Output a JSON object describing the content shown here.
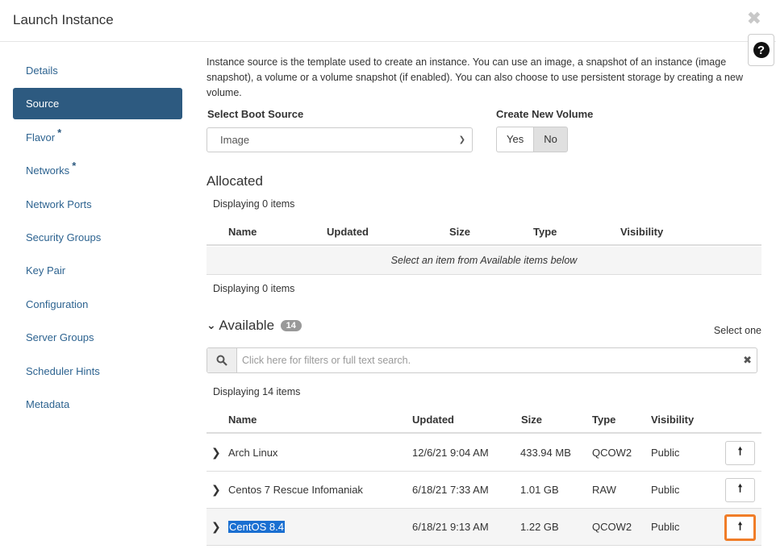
{
  "modal": {
    "title": "Launch Instance",
    "close_glyph": "✖",
    "help_glyph": "?"
  },
  "sidebar": {
    "items": [
      {
        "label": "Details",
        "required": false,
        "active": false
      },
      {
        "label": "Source",
        "required": false,
        "active": true
      },
      {
        "label": "Flavor",
        "required": true,
        "active": false
      },
      {
        "label": "Networks",
        "required": true,
        "active": false
      },
      {
        "label": "Network Ports",
        "required": false,
        "active": false
      },
      {
        "label": "Security Groups",
        "required": false,
        "active": false
      },
      {
        "label": "Key Pair",
        "required": false,
        "active": false
      },
      {
        "label": "Configuration",
        "required": false,
        "active": false
      },
      {
        "label": "Server Groups",
        "required": false,
        "active": false
      },
      {
        "label": "Scheduler Hints",
        "required": false,
        "active": false
      },
      {
        "label": "Metadata",
        "required": false,
        "active": false
      }
    ],
    "required_marker": "*"
  },
  "source": {
    "intro": "Instance source is the template used to create an instance. You can use an image, a snapshot of an instance (image snapshot), a volume or a volume snapshot (if enabled). You can also choose to use persistent storage by creating a new volume.",
    "boot_source_label": "Select Boot Source",
    "boot_source_value": "Image",
    "new_volume_label": "Create New Volume",
    "yes_label": "Yes",
    "no_label": "No",
    "no_selected": true
  },
  "allocated": {
    "title": "Allocated",
    "count_text_top": "Displaying 0 items",
    "count_text_bottom": "Displaying 0 items",
    "columns": [
      "Name",
      "Updated",
      "Size",
      "Type",
      "Visibility"
    ],
    "empty_message": "Select an item from Available items below"
  },
  "available": {
    "title": "Available",
    "count_badge": "14",
    "select_hint": "Select one",
    "search_placeholder": "Click here for filters or full text search.",
    "count_text": "Displaying 14 items",
    "columns": [
      "Name",
      "Updated",
      "Size",
      "Type",
      "Visibility"
    ],
    "rows": [
      {
        "name": "Arch Linux",
        "updated": "12/6/21 9:04 AM",
        "size": "433.94 MB",
        "type": "QCOW2",
        "visibility": "Public"
      },
      {
        "name": "Centos 7 Rescue Infomaniak",
        "updated": "6/18/21 7:33 AM",
        "size": "1.01 GB",
        "type": "RAW",
        "visibility": "Public"
      },
      {
        "name": "CentOS 8.4",
        "updated": "6/18/21 9:13 AM",
        "size": "1.22 GB",
        "type": "QCOW2",
        "visibility": "Public"
      }
    ]
  },
  "colors": {
    "accent": "#2d5a80",
    "link": "#2d6390",
    "focus": "#f07d28",
    "selection": "#1a6fd1"
  }
}
